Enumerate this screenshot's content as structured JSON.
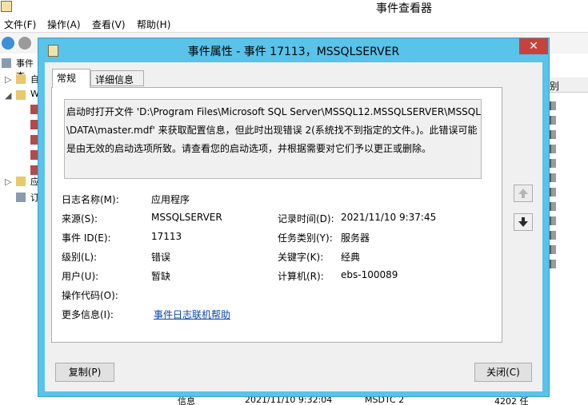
{
  "window": {
    "title": "事件查看器"
  },
  "menu": [
    "文件(F)",
    "操作(A)",
    "查看(V)",
    "帮助(H)"
  ],
  "tree": {
    "items": [
      "事件查",
      "自",
      "W",
      "应",
      "订"
    ]
  },
  "list": {
    "header": "别",
    "bottom_row": [
      "信息",
      "2021/11/10 9:32:04",
      "MSDTC 2",
      "4202 任"
    ]
  },
  "dialog": {
    "title": "事件属性 - 事件 17113，MSSQLSERVER",
    "close_label": "✕",
    "tabs": [
      "常规",
      "详细信息"
    ],
    "message_lines": [
      "启动时打开文件 'D:\\Program Files\\Microsoft SQL Server\\MSSQL12.MSSQLSERVER\\MSSQL",
      "\\DATA\\master.mdf' 来获取配置信息，但此时出现错误 2(系统找不到指定的文件。)。此错误可能",
      "是由无效的启动选项所致。请查看您的启动选项，并根据需要对它们予以更正或删除。"
    ],
    "fields": {
      "log_name_label": "日志名称(M):",
      "log_name": "应用程序",
      "source_label": "来源(S):",
      "source": "MSSQLSERVER",
      "logged_label": "记录时间(D):",
      "logged": "2021/11/10 9:37:45",
      "event_id_label": "事件 ID(E):",
      "event_id": "17113",
      "task_label": "任务类别(Y):",
      "task": "服务器",
      "level_label": "级别(L):",
      "level": "错误",
      "keywords_label": "关键字(K):",
      "keywords": "经典",
      "user_label": "用户(U):",
      "user": "暂缺",
      "computer_label": "计算机(R):",
      "computer": "ebs-100089",
      "opcode_label": "操作代码(O):",
      "opcode": "",
      "more_info_label": "更多信息(I):",
      "more_info_link": "事件日志联机帮助"
    },
    "buttons": {
      "copy": "复制(P)",
      "close": "关闭(C)"
    }
  },
  "colors": {
    "dialog_frame": "#59c3e9",
    "close_button": "#c7423a",
    "link": "#0645ad"
  }
}
